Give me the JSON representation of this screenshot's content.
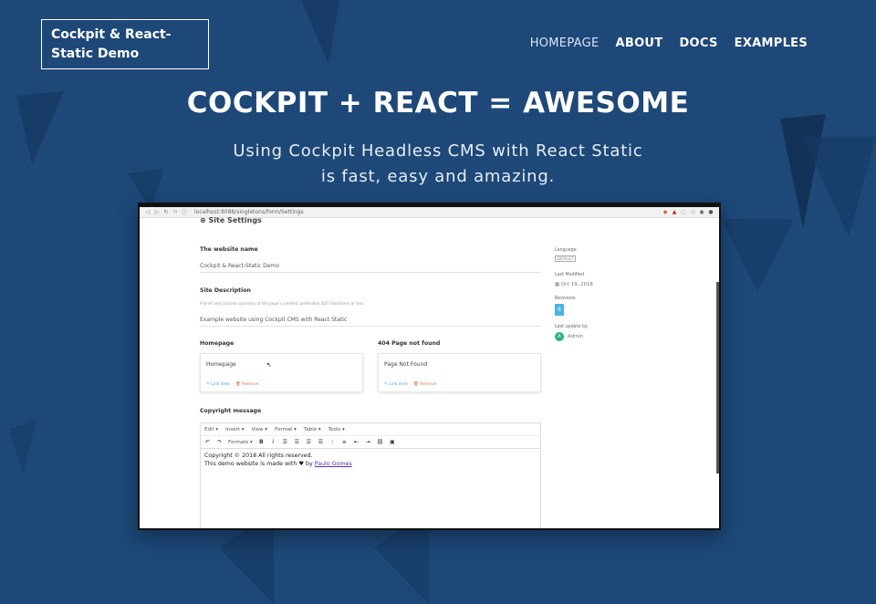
{
  "site": {
    "brand": "Cockpit & React-Static Demo",
    "nav": [
      "HOMEPAGE",
      "ABOUT",
      "DOCS",
      "EXAMPLES"
    ],
    "hero_title": "COCKPIT + REACT = AWESOME",
    "hero_sub_line1": "Using Cockpit Headless CMS with React Static",
    "hero_sub_line2": "is fast, easy and amazing."
  },
  "browser": {
    "url": "localhost:8088/singletons/form/Settings",
    "back": "◁",
    "forward": "▷",
    "reload": "↻",
    "bookmark": "⌑",
    "info": "ⓘ"
  },
  "cms": {
    "section_title": "Site Settings",
    "website_name_label": "The website name",
    "website_name_value": "Cockpit & React-Static Demo",
    "site_description_label": "Site Description",
    "site_description_hint": "A brief and concise summary of the page's content, preferably 320 characters or less.",
    "site_description_value": "Example website using Cockpit CMS with React Static",
    "homepage_label": "Homepage",
    "homepage_value": "Homepage",
    "notfound_label": "404 Page not found",
    "notfound_value": "Page Not Found",
    "link_item": "✎ Link item",
    "remove": "🗑 Remove",
    "copyright_label": "Copyright message",
    "menu": [
      "Edit ▾",
      "Insert ▾",
      "View ▾",
      "Format ▾",
      "Table ▾",
      "Tools ▾"
    ],
    "formats": "Formats ▾",
    "content_line1": "Copyright © 2018 All rights reserved.",
    "content_line2_prefix": "This demo website is made with ♥ by ",
    "content_link": "Paulo Gomes"
  },
  "sidebar": {
    "language_label": "Language",
    "language_value": "DEFAULT",
    "modified_label": "Last Modified",
    "modified_value": "Oct 19, 2018",
    "revisions_label": "Revisions",
    "revisions_value": "6",
    "update_label": "Last update by",
    "update_avatar": "A",
    "update_value": "Admin"
  }
}
